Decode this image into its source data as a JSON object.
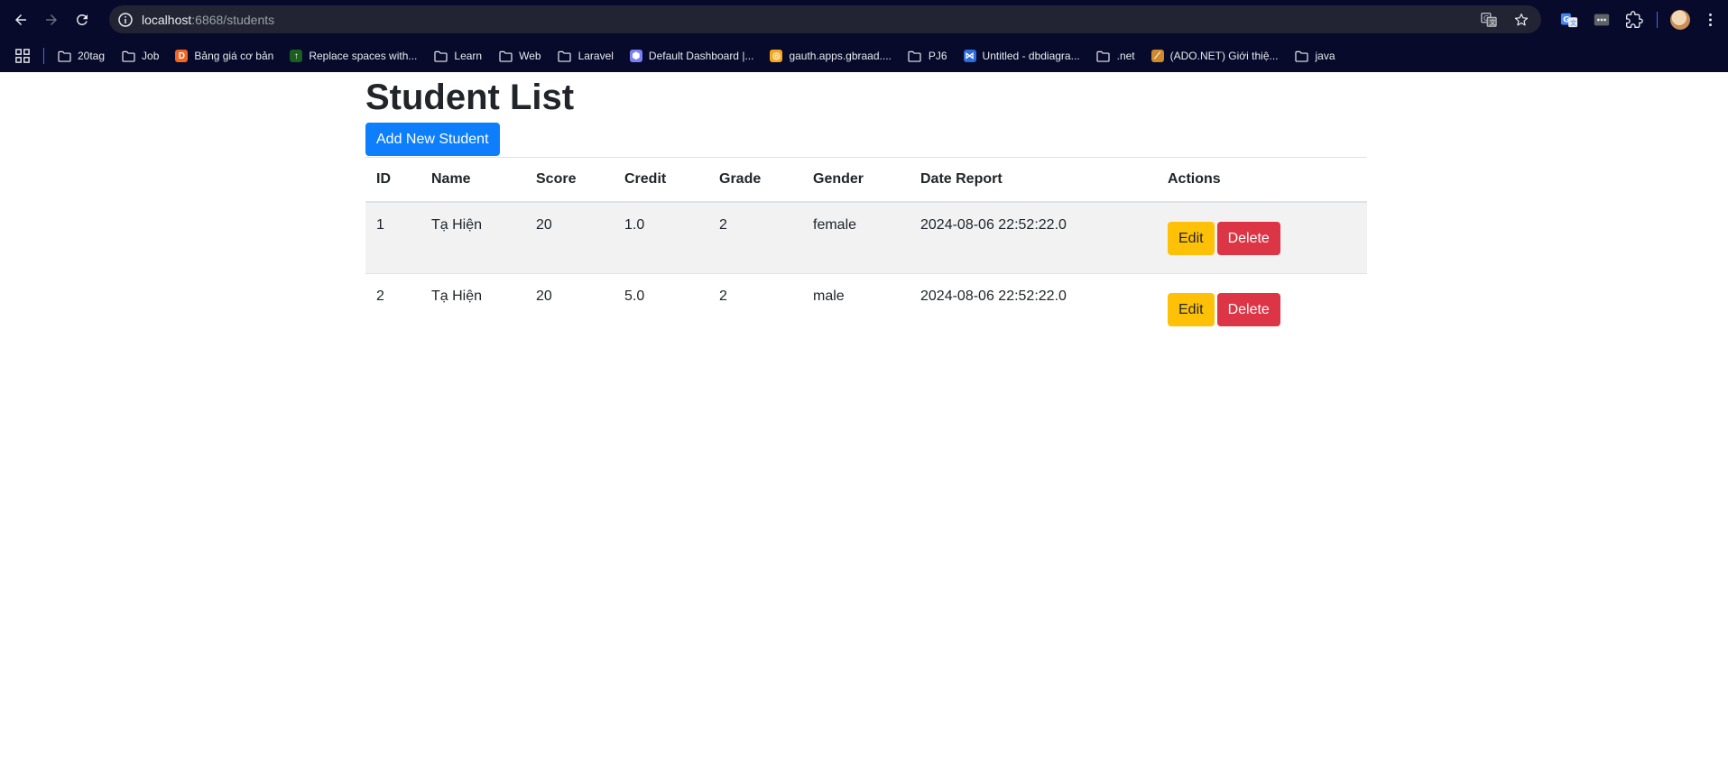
{
  "browser": {
    "url_host": "localhost",
    "url_rest": ":6868/students",
    "bookmarks": [
      {
        "label": "20tag",
        "icon": "folder-icon"
      },
      {
        "label": "Job",
        "icon": "folder-icon"
      },
      {
        "label": "Bảng giá cơ bản",
        "icon": "site-favicon",
        "color": "#f26522",
        "glyph": "D"
      },
      {
        "label": "Replace spaces with...",
        "icon": "site-favicon",
        "color": "#1b5e20",
        "glyph": "↑"
      },
      {
        "label": "Learn",
        "icon": "folder-icon"
      },
      {
        "label": "Web",
        "icon": "folder-icon"
      },
      {
        "label": "Laravel",
        "icon": "folder-icon"
      },
      {
        "label": "Default Dashboard |...",
        "icon": "site-favicon",
        "color": "#7b7ff5",
        "glyph": "⬢"
      },
      {
        "label": "gauth.apps.gbraad....",
        "icon": "site-favicon",
        "color": "#f5a623",
        "glyph": "◎"
      },
      {
        "label": "PJ6",
        "icon": "folder-icon"
      },
      {
        "label": "Untitled - dbdiagra...",
        "icon": "site-favicon",
        "color": "#2d6cdf",
        "glyph": "⋈"
      },
      {
        "label": ".net",
        "icon": "folder-icon"
      },
      {
        "label": "(ADO.NET) Giới thiệ...",
        "icon": "site-favicon",
        "color": "#d08a2c",
        "glyph": "⟋"
      },
      {
        "label": "java",
        "icon": "folder-icon"
      }
    ]
  },
  "page": {
    "title": "Student List",
    "add_button": "Add New Student",
    "columns": [
      "ID",
      "Name",
      "Score",
      "Credit",
      "Grade",
      "Gender",
      "Date Report",
      "Actions"
    ],
    "rows": [
      {
        "id": "1",
        "name": "Tạ Hiện",
        "score": "20",
        "credit": "1.0",
        "grade": "2",
        "gender": "female",
        "date": "2024-08-06 22:52:22.0",
        "edit": "Edit",
        "delete": "Delete"
      },
      {
        "id": "2",
        "name": "Tạ Hiện",
        "score": "20",
        "credit": "5.0",
        "grade": "2",
        "gender": "male",
        "date": "2024-08-06 22:52:22.0",
        "edit": "Edit",
        "delete": "Delete"
      }
    ]
  },
  "colors": {
    "chrome_bg": "#070a2a",
    "primary": "#0d7ffc",
    "warning": "#ffc107",
    "danger": "#dc3545",
    "stripe": "#f2f2f2"
  }
}
